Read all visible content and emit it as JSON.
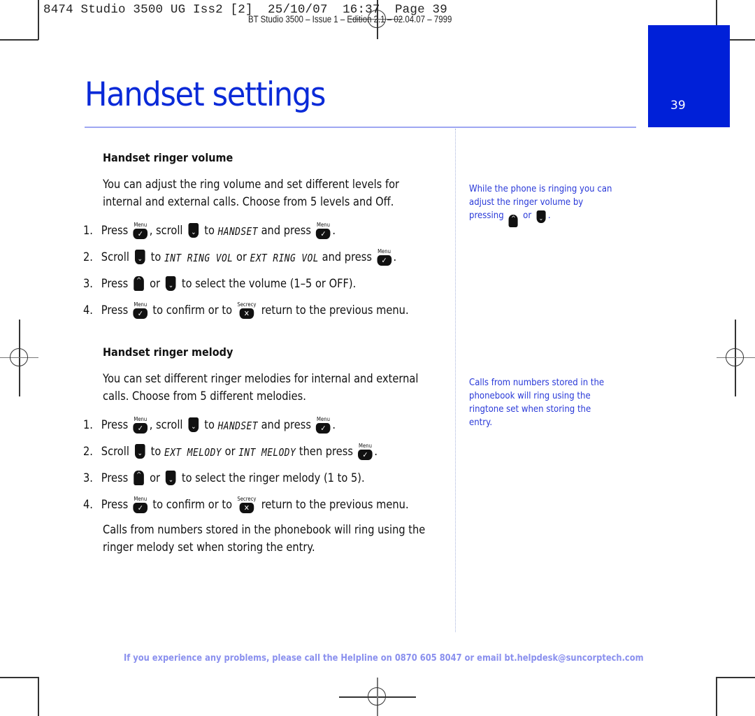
{
  "print_slug": {
    "job_line": "8474 Studio 3500 UG Iss2 [2]  25/10/07  16:37  Page 39",
    "edition_line": "BT Studio 3500 – Issue 1 – Edition 2.1 – 02.04.07 – 7999"
  },
  "page": {
    "number": "39",
    "title": "Handset settings",
    "accent_color": "#0020d8"
  },
  "keys": {
    "menu_label": "Menu",
    "menu_glyph": "✓",
    "secrecy_label": "Secrecy",
    "secrecy_glyph": "✕",
    "up_glyph": "^",
    "down_glyph": "⌄"
  },
  "sections": [
    {
      "heading": "Handset ringer volume",
      "intro": "You can adjust the ring volume and set different levels for internal and external calls. Choose from 5 levels and Off.",
      "steps": [
        {
          "num": "1.",
          "a": "Press ",
          "b": ", scroll ",
          "c": " to ",
          "lcd": "HANDSET",
          "d": " and press ",
          "e": "."
        },
        {
          "num": "2.",
          "a": "Scroll ",
          "b": " to ",
          "lcd1": "INT RING VOL",
          "c": " or ",
          "lcd2": "EXT RING VOL",
          "d": " and press ",
          "e": "."
        },
        {
          "num": "3.",
          "a": "Press ",
          "b": " or ",
          "c": " to select the volume (1–5 or OFF)."
        },
        {
          "num": "4.",
          "a": "Press ",
          "b": " to confirm or to ",
          "c": " return to the previous menu."
        }
      ]
    },
    {
      "heading": "Handset ringer melody",
      "intro": "You can set different ringer melodies for internal and external calls. Choose from 5 different melodies.",
      "steps": [
        {
          "num": "1.",
          "a": "Press ",
          "b": ", scroll ",
          "c": " to ",
          "lcd": "HANDSET",
          "d": " and press ",
          "e": "."
        },
        {
          "num": "2.",
          "a": "Scroll ",
          "b": " to ",
          "lcd1": "EXT MELODY",
          "c": " or ",
          "lcd2": "INT MELODY",
          "d": " then press ",
          "e": "."
        },
        {
          "num": "3.",
          "a": "Press ",
          "b": " or ",
          "c": " to select the ringer melody (1 to 5)."
        },
        {
          "num": "4.",
          "a": "Press ",
          "b": " to confirm or to ",
          "c": " return to the previous menu."
        }
      ],
      "outro": "Calls from numbers stored in the phonebook will ring using the ringer melody set when storing the entry."
    }
  ],
  "side_notes": [
    {
      "a": "While the phone is ringing you can adjust the ringer volume by pressing ",
      "b": " or ",
      "c": "."
    },
    {
      "text": "Calls from numbers stored in the phonebook will ring using the ringtone set when storing the entry."
    }
  ],
  "footer": "If you experience any problems, please call the Helpline on 0870 605 8047 or email bt.helpdesk@suncorptech.com"
}
